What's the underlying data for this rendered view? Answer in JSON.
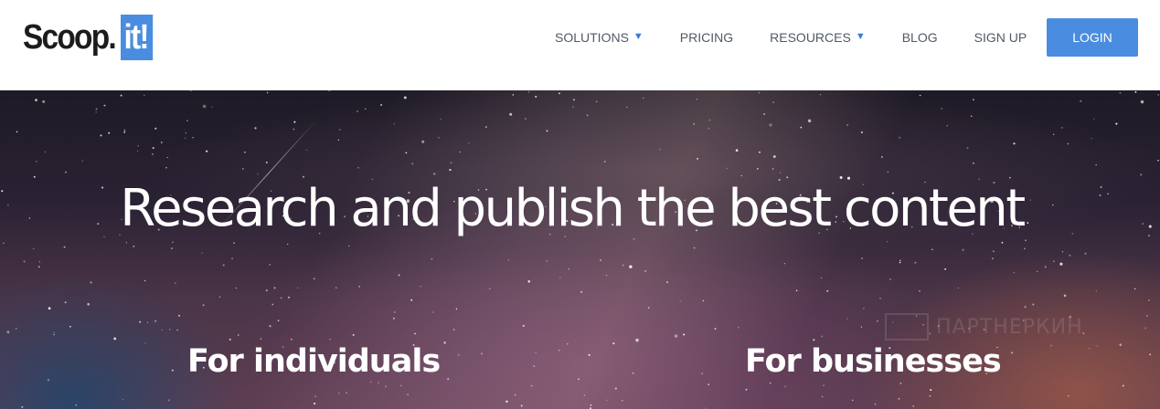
{
  "header": {
    "logo": {
      "text": "Scoop.",
      "box_text": "it!",
      "box_color": "#4a8de0"
    },
    "nav": [
      {
        "label": "SOLUTIONS",
        "has_dropdown": true
      },
      {
        "label": "PRICING",
        "has_dropdown": false
      },
      {
        "label": "RESOURCES",
        "has_dropdown": true
      },
      {
        "label": "BLOG",
        "has_dropdown": false
      },
      {
        "label": "SIGN UP",
        "has_dropdown": false
      }
    ],
    "dropdown_caret": "▼",
    "login_label": "LOGIN",
    "accent_color": "#4a8de0"
  },
  "hero": {
    "title": "Research and publish the best content",
    "left_label": "For individuals",
    "right_label": "For businesses",
    "watermark": "ПАРТНЕРКИН"
  }
}
